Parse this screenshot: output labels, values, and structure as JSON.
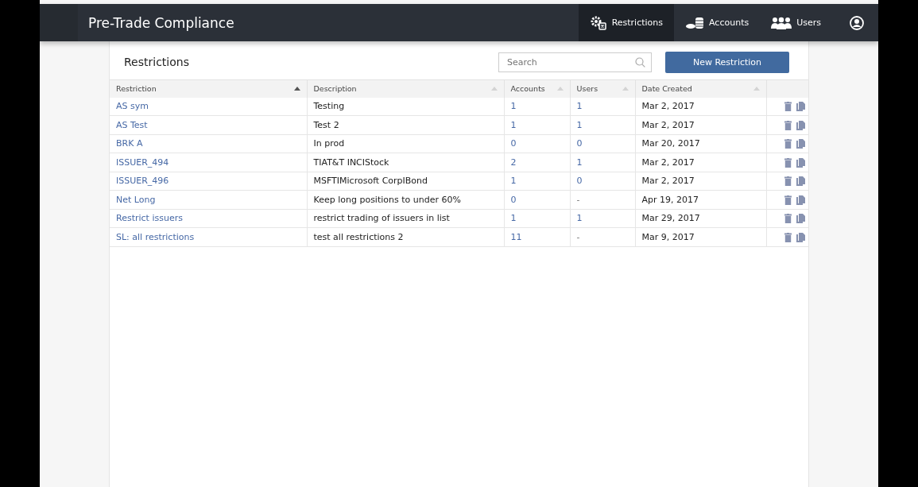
{
  "app": {
    "title": "Pre-Trade Compliance"
  },
  "nav": [
    {
      "label": "Restrictions",
      "selected": true
    },
    {
      "label": "Accounts",
      "selected": false
    },
    {
      "label": "Users",
      "selected": false
    }
  ],
  "page": {
    "title": "Restrictions",
    "search": {
      "placeholder": "Search"
    },
    "new_button": "New Restriction"
  },
  "table": {
    "columns": [
      {
        "label": "Restriction",
        "sorted": true
      },
      {
        "label": "Description",
        "sorted": false
      },
      {
        "label": "Accounts",
        "sorted": false
      },
      {
        "label": "Users",
        "sorted": false
      },
      {
        "label": "Date Created",
        "sorted": false
      }
    ],
    "rows": [
      {
        "name": "AS sym",
        "description": "Testing",
        "accounts": "1",
        "users": "1",
        "date": "Mar 2, 2017"
      },
      {
        "name": "AS Test",
        "description": "Test 2",
        "accounts": "1",
        "users": "1",
        "date": "Mar 2, 2017"
      },
      {
        "name": "BRK A",
        "description": "In prod",
        "accounts": "0",
        "users": "0",
        "date": "Mar 20, 2017"
      },
      {
        "name": "ISSUER_494",
        "description": "TIAT&T INCIStock",
        "accounts": "2",
        "users": "1",
        "date": "Mar 2, 2017"
      },
      {
        "name": "ISSUER_496",
        "description": "MSFTIMicrosoft CorpIBond",
        "accounts": "1",
        "users": "0",
        "date": "Mar 2, 2017"
      },
      {
        "name": "Net Long",
        "description": "Keep long positions to under 60%",
        "accounts": "0",
        "users": "-",
        "date": "Apr 19, 2017"
      },
      {
        "name": "Restrict issuers",
        "description": "restrict trading of issuers in list",
        "accounts": "1",
        "users": "1",
        "date": "Mar 29, 2017"
      },
      {
        "name": "SL: all restrictions",
        "description": "test all restrictions 2",
        "accounts": "11",
        "users": "-",
        "date": "Mar 9, 2017"
      }
    ]
  }
}
